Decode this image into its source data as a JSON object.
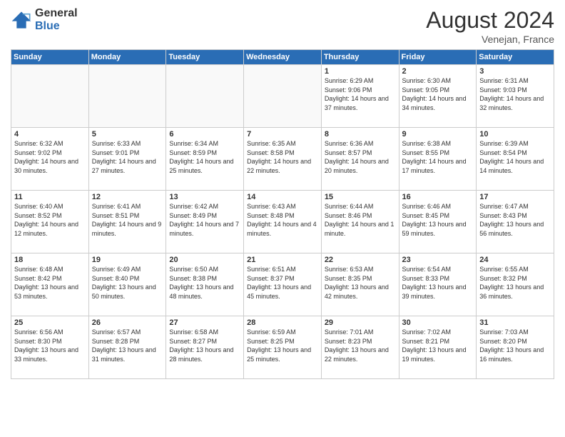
{
  "header": {
    "logo_general": "General",
    "logo_blue": "Blue",
    "month_title": "August 2024",
    "location": "Venejan, France"
  },
  "days_of_week": [
    "Sunday",
    "Monday",
    "Tuesday",
    "Wednesday",
    "Thursday",
    "Friday",
    "Saturday"
  ],
  "weeks": [
    [
      {
        "day": "",
        "sunrise": "",
        "sunset": "",
        "daylight": ""
      },
      {
        "day": "",
        "sunrise": "",
        "sunset": "",
        "daylight": ""
      },
      {
        "day": "",
        "sunrise": "",
        "sunset": "",
        "daylight": ""
      },
      {
        "day": "",
        "sunrise": "",
        "sunset": "",
        "daylight": ""
      },
      {
        "day": "1",
        "sunrise": "Sunrise: 6:29 AM",
        "sunset": "Sunset: 9:06 PM",
        "daylight": "Daylight: 14 hours and 37 minutes."
      },
      {
        "day": "2",
        "sunrise": "Sunrise: 6:30 AM",
        "sunset": "Sunset: 9:05 PM",
        "daylight": "Daylight: 14 hours and 34 minutes."
      },
      {
        "day": "3",
        "sunrise": "Sunrise: 6:31 AM",
        "sunset": "Sunset: 9:03 PM",
        "daylight": "Daylight: 14 hours and 32 minutes."
      }
    ],
    [
      {
        "day": "4",
        "sunrise": "Sunrise: 6:32 AM",
        "sunset": "Sunset: 9:02 PM",
        "daylight": "Daylight: 14 hours and 30 minutes."
      },
      {
        "day": "5",
        "sunrise": "Sunrise: 6:33 AM",
        "sunset": "Sunset: 9:01 PM",
        "daylight": "Daylight: 14 hours and 27 minutes."
      },
      {
        "day": "6",
        "sunrise": "Sunrise: 6:34 AM",
        "sunset": "Sunset: 8:59 PM",
        "daylight": "Daylight: 14 hours and 25 minutes."
      },
      {
        "day": "7",
        "sunrise": "Sunrise: 6:35 AM",
        "sunset": "Sunset: 8:58 PM",
        "daylight": "Daylight: 14 hours and 22 minutes."
      },
      {
        "day": "8",
        "sunrise": "Sunrise: 6:36 AM",
        "sunset": "Sunset: 8:57 PM",
        "daylight": "Daylight: 14 hours and 20 minutes."
      },
      {
        "day": "9",
        "sunrise": "Sunrise: 6:38 AM",
        "sunset": "Sunset: 8:55 PM",
        "daylight": "Daylight: 14 hours and 17 minutes."
      },
      {
        "day": "10",
        "sunrise": "Sunrise: 6:39 AM",
        "sunset": "Sunset: 8:54 PM",
        "daylight": "Daylight: 14 hours and 14 minutes."
      }
    ],
    [
      {
        "day": "11",
        "sunrise": "Sunrise: 6:40 AM",
        "sunset": "Sunset: 8:52 PM",
        "daylight": "Daylight: 14 hours and 12 minutes."
      },
      {
        "day": "12",
        "sunrise": "Sunrise: 6:41 AM",
        "sunset": "Sunset: 8:51 PM",
        "daylight": "Daylight: 14 hours and 9 minutes."
      },
      {
        "day": "13",
        "sunrise": "Sunrise: 6:42 AM",
        "sunset": "Sunset: 8:49 PM",
        "daylight": "Daylight: 14 hours and 7 minutes."
      },
      {
        "day": "14",
        "sunrise": "Sunrise: 6:43 AM",
        "sunset": "Sunset: 8:48 PM",
        "daylight": "Daylight: 14 hours and 4 minutes."
      },
      {
        "day": "15",
        "sunrise": "Sunrise: 6:44 AM",
        "sunset": "Sunset: 8:46 PM",
        "daylight": "Daylight: 14 hours and 1 minute."
      },
      {
        "day": "16",
        "sunrise": "Sunrise: 6:46 AM",
        "sunset": "Sunset: 8:45 PM",
        "daylight": "Daylight: 13 hours and 59 minutes."
      },
      {
        "day": "17",
        "sunrise": "Sunrise: 6:47 AM",
        "sunset": "Sunset: 8:43 PM",
        "daylight": "Daylight: 13 hours and 56 minutes."
      }
    ],
    [
      {
        "day": "18",
        "sunrise": "Sunrise: 6:48 AM",
        "sunset": "Sunset: 8:42 PM",
        "daylight": "Daylight: 13 hours and 53 minutes."
      },
      {
        "day": "19",
        "sunrise": "Sunrise: 6:49 AM",
        "sunset": "Sunset: 8:40 PM",
        "daylight": "Daylight: 13 hours and 50 minutes."
      },
      {
        "day": "20",
        "sunrise": "Sunrise: 6:50 AM",
        "sunset": "Sunset: 8:38 PM",
        "daylight": "Daylight: 13 hours and 48 minutes."
      },
      {
        "day": "21",
        "sunrise": "Sunrise: 6:51 AM",
        "sunset": "Sunset: 8:37 PM",
        "daylight": "Daylight: 13 hours and 45 minutes."
      },
      {
        "day": "22",
        "sunrise": "Sunrise: 6:53 AM",
        "sunset": "Sunset: 8:35 PM",
        "daylight": "Daylight: 13 hours and 42 minutes."
      },
      {
        "day": "23",
        "sunrise": "Sunrise: 6:54 AM",
        "sunset": "Sunset: 8:33 PM",
        "daylight": "Daylight: 13 hours and 39 minutes."
      },
      {
        "day": "24",
        "sunrise": "Sunrise: 6:55 AM",
        "sunset": "Sunset: 8:32 PM",
        "daylight": "Daylight: 13 hours and 36 minutes."
      }
    ],
    [
      {
        "day": "25",
        "sunrise": "Sunrise: 6:56 AM",
        "sunset": "Sunset: 8:30 PM",
        "daylight": "Daylight: 13 hours and 33 minutes."
      },
      {
        "day": "26",
        "sunrise": "Sunrise: 6:57 AM",
        "sunset": "Sunset: 8:28 PM",
        "daylight": "Daylight: 13 hours and 31 minutes."
      },
      {
        "day": "27",
        "sunrise": "Sunrise: 6:58 AM",
        "sunset": "Sunset: 8:27 PM",
        "daylight": "Daylight: 13 hours and 28 minutes."
      },
      {
        "day": "28",
        "sunrise": "Sunrise: 6:59 AM",
        "sunset": "Sunset: 8:25 PM",
        "daylight": "Daylight: 13 hours and 25 minutes."
      },
      {
        "day": "29",
        "sunrise": "Sunrise: 7:01 AM",
        "sunset": "Sunset: 8:23 PM",
        "daylight": "Daylight: 13 hours and 22 minutes."
      },
      {
        "day": "30",
        "sunrise": "Sunrise: 7:02 AM",
        "sunset": "Sunset: 8:21 PM",
        "daylight": "Daylight: 13 hours and 19 minutes."
      },
      {
        "day": "31",
        "sunrise": "Sunrise: 7:03 AM",
        "sunset": "Sunset: 8:20 PM",
        "daylight": "Daylight: 13 hours and 16 minutes."
      }
    ]
  ]
}
